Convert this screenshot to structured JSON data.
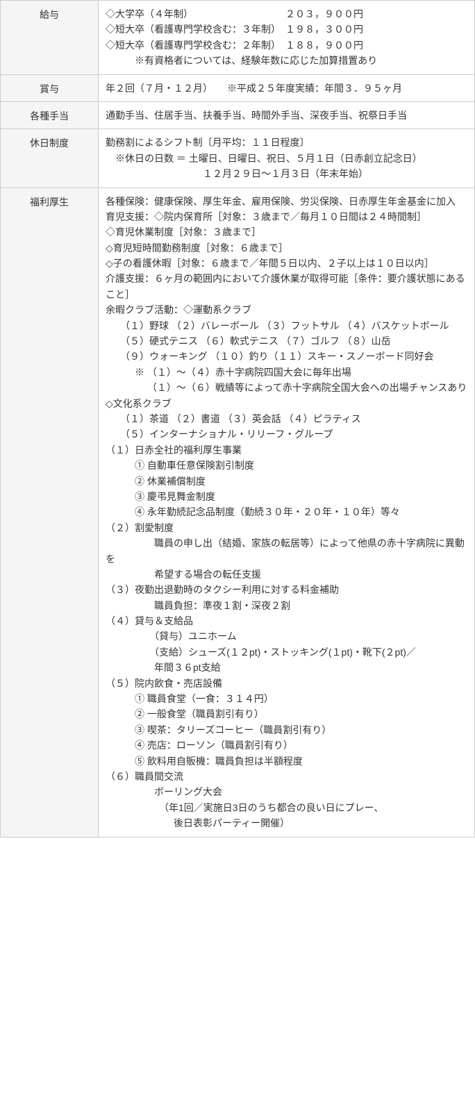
{
  "rows": [
    {
      "label": "給与",
      "content": "◇大学卒（４年制）　　　　　　　　　　２０３，９００円\n◇短大卒（看護専門学校含む：３年制）　１９８，３００円\n◇短大卒（看護専門学校含む：２年制）　１８８，９００円\n　　　※有資格者については、経験年数に応じた加算措置あり"
    },
    {
      "label": "賞与",
      "content": "年２回（７月・１２月）　　※平成２５年度実績：年間３．９５ヶ月"
    },
    {
      "label": "各種手当",
      "content": "通勤手当、住居手当、扶養手当、時間外手当、深夜手当、祝祭日手当"
    },
    {
      "label": "休日制度",
      "content": "勤務割によるシフト制〔月平均：１１日程度〕\n　※休日の日数 ＝ 土曜日、日曜日、祝日、５月１日（日赤創立記念日）\n　　　　　　　　　　１２月２９日～１月３日（年末年始）"
    },
    {
      "label": "福利厚生",
      "content": "各種保険：健康保険、厚生年金、雇用保険、労災保険、日赤厚生年金基金に加入\n育児支援：◇院内保育所［対象：３歳まで／毎月１０日間は２４時間制］\n◇育児休業制度［対象：３歳まで］\n◇育児短時間勤務制度［対象：６歳まで］\n◇子の看護休暇［対象：６歳まで／年間５日以内、２子以上は１０日以内］\n介護支援：６ヶ月の範囲内において介護休業が取得可能［条件：要介護状態にあること］\n余暇クラブ活動：◇運動系クラブ\n　　（１）野球 （２）バレーボール （３）フットサル （４）バスケットボール\n　　（５）硬式テニス （６）軟式テニス （７）ゴルフ （８）山岳\n　　（９）ウォーキング （１０）釣り（１１）スキー・スノーボード同好会\n　　　※ （１）～（４）赤十字病院四国大会に毎年出場\n　　　　 （１）～（６）戦績等によって赤十字病院全国大会への出場チャンスあり\n◇文化系クラブ\n　　（１）茶道 （２）書道 （３）英会話 （４）ピラティス\n　　（５）インターナショナル・リリーフ・グループ\n（１）日赤全社的福利厚生事業\n　　　① 自動車任意保険割引制度\n　　　② 休業補償制度\n　　　③ 慶弔見舞金制度\n　　　④ 永年勤続記念品制度（勤続３０年・２０年・１０年）等々\n（２）割愛制度\n　　　　　職員の申し出（結婚、家族の転居等）によって他県の赤十字病院に異動を\n　　　　　希望する場合の転任支援\n（３）夜勤出退勤時のタクシー利用に対する料金補助\n　　　　　職員負担：準夜１割・深夜２割\n（４）貸与＆支給品\n　　　　　（貸与）ユニホーム\n　　　　　（支給）シューズ(１２pt)・ストッキング(１pt)・靴下(２pt)／\n　　　　　年間３６pt支給\n（５）院内飲食・売店設備\n　　　① 職員食堂（一食：３１４円）\n　　　② 一般食堂（職員割引有り）\n　　　③ 喫茶：タリーズコーヒー（職員割引有り）\n　　　④ 売店：ローソン（職員割引有り）\n　　　⑤ 飲料用自販機：職員負担は半額程度\n（６）職員間交流\n　　　　　ボーリング大会\n　　　　　　（年1回／実施日3日のうち都合の良い日にプレー、\n　　　　　　　後日表彰パーティー開催）"
    }
  ]
}
